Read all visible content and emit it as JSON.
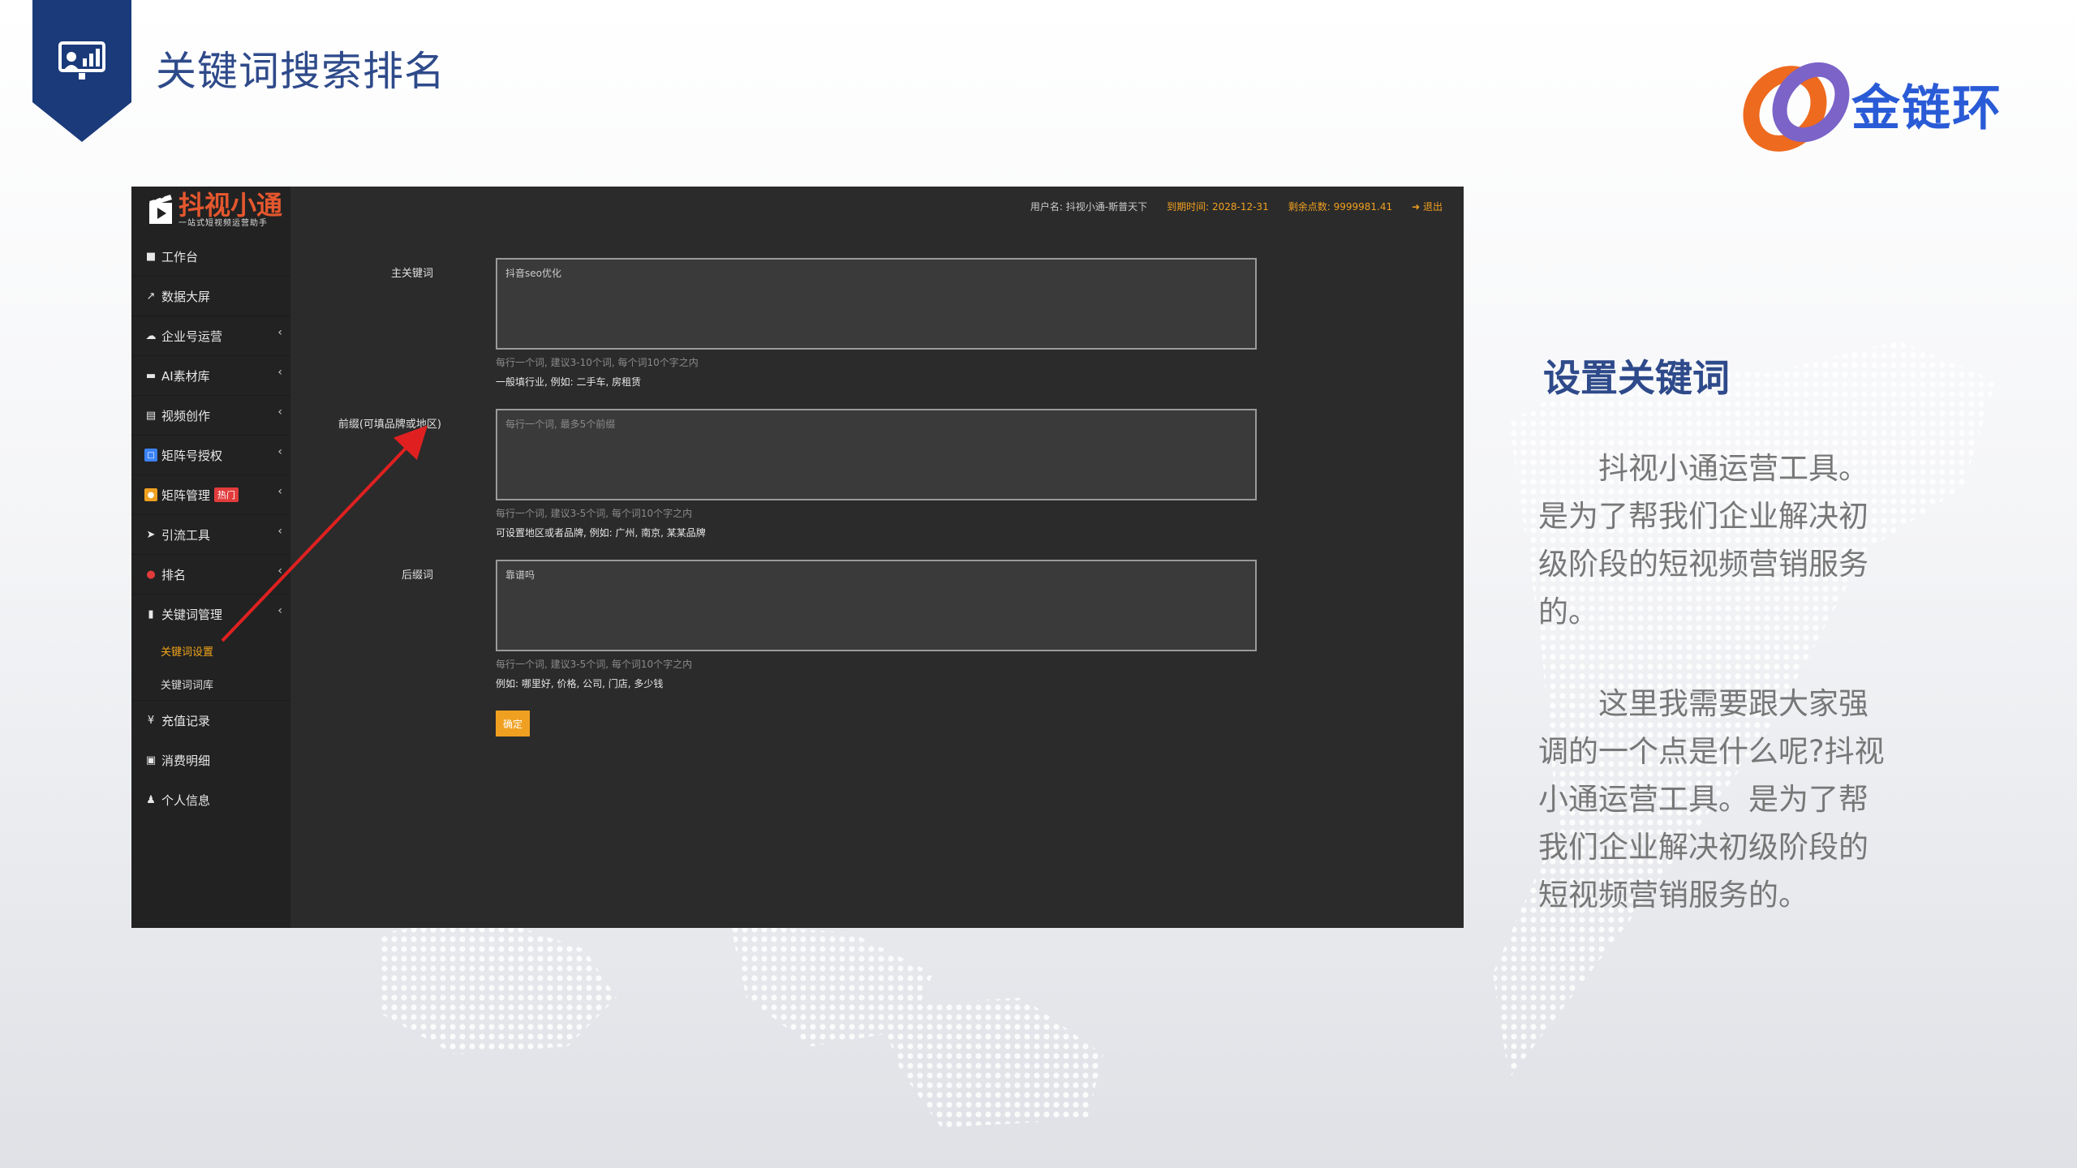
{
  "slide": {
    "title": "关键词搜索排名",
    "brand_name": "金链环"
  },
  "app": {
    "logo_name": "抖视小通",
    "logo_sub": "一站式短视频运营助手",
    "topbar": {
      "user": "用户名: 抖视小通-斯普天下",
      "expire": "到期时间: 2028-12-31",
      "points": "剩余点数: 9999981.41",
      "logout": "退出"
    },
    "nav": [
      {
        "label": "工作台",
        "icon": "dashboard-icon"
      },
      {
        "label": "数据大屏",
        "icon": "chart-icon"
      },
      {
        "label": "企业号运营",
        "icon": "cloud-icon",
        "has_children": true
      },
      {
        "label": "AI素材库",
        "icon": "folder-icon",
        "has_children": true
      },
      {
        "label": "视频创作",
        "icon": "film-icon",
        "has_children": true
      },
      {
        "label": "矩阵号授权",
        "icon": "auth-icon",
        "has_children": true
      },
      {
        "label": "矩阵管理",
        "icon": "matrix-icon",
        "badge": "热门",
        "has_children": true
      },
      {
        "label": "引流工具",
        "icon": "send-icon",
        "has_children": true
      },
      {
        "label": "排名",
        "icon": "rank-icon",
        "has_children": true
      },
      {
        "label": "关键词管理",
        "icon": "file-icon",
        "has_children": true,
        "expanded": true
      }
    ],
    "sub_nav": [
      {
        "label": "关键词设置",
        "active": true
      },
      {
        "label": "关键词词库",
        "active": false
      }
    ],
    "nav_bottom": [
      {
        "label": "充值记录",
        "icon": "yen-icon"
      },
      {
        "label": "消费明细",
        "icon": "money-icon"
      },
      {
        "label": "个人信息",
        "icon": "user-icon"
      }
    ],
    "form": {
      "main_label": "主关键词",
      "main_value": "抖音seo优化",
      "main_hint": "每行一个词, 建议3-10个词, 每个词10个字之内",
      "main_example": "一般填行业, 例如: 二手车, 房租赁",
      "prefix_label": "前缀(可填品牌或地区)",
      "prefix_placeholder": "每行一个词, 最多5个前缀",
      "prefix_hint": "每行一个词, 建议3-5个词, 每个词10个字之内",
      "prefix_example": "可设置地区或者品牌, 例如: 广州, 南京, 某某品牌",
      "suffix_label": "后缀词",
      "suffix_value": "靠谱吗",
      "suffix_hint": "每行一个词, 建议3-5个词, 每个词10个字之内",
      "suffix_example": "例如: 哪里好, 价格, 公司, 门店, 多少钱",
      "submit_label": "确定"
    }
  },
  "right_panel": {
    "heading": "设置关键词",
    "para1": "抖视小通运营工具。是为了帮我们企业解决初级阶段的短视频营销服务的。",
    "para2": "这里我需要跟大家强调的一个点是什么呢?抖视小通运营工具。是为了帮我们企业解决初级阶段的短视频营销服务的。"
  },
  "colors": {
    "accent_blue": "#2e4a8a",
    "badge_navy": "#1a3a7a",
    "app_bg": "#2b2b2b",
    "app_orange": "#f0a020",
    "annotation_red": "#e02020"
  }
}
